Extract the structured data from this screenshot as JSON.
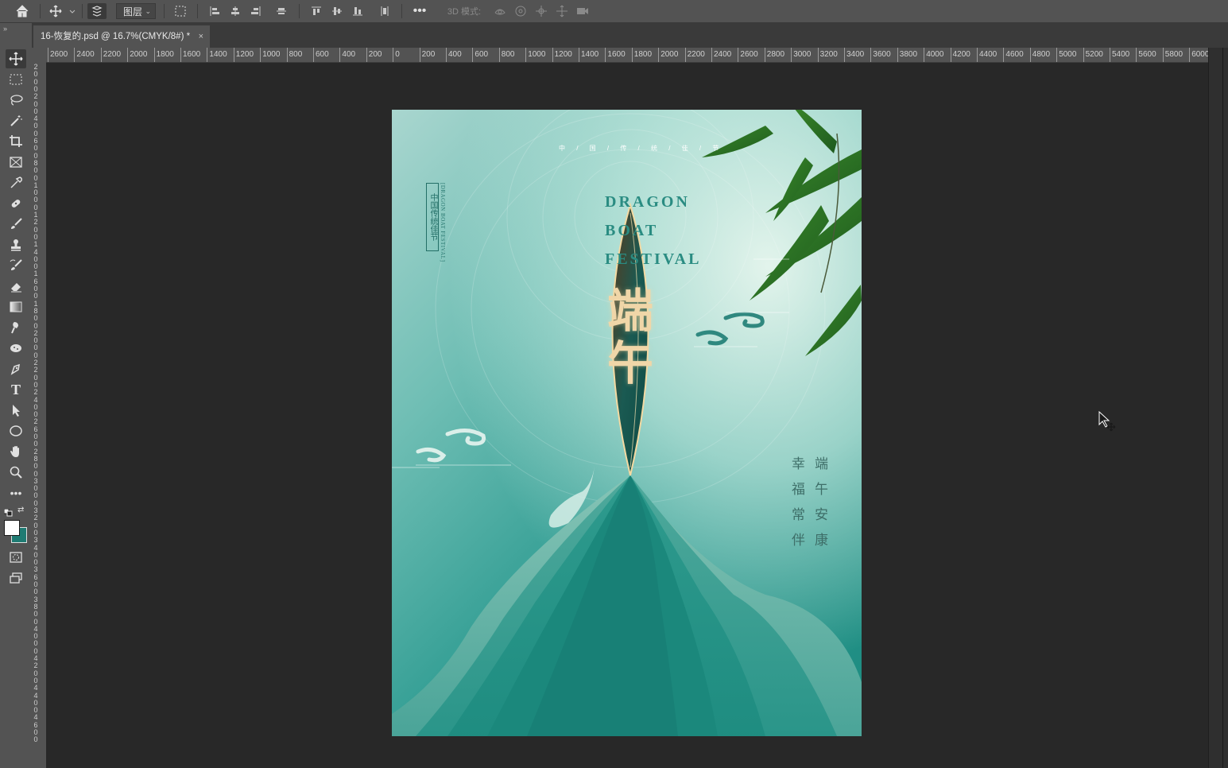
{
  "options_bar": {
    "layer_select_value": "图层",
    "three_d_mode_label": "3D 模式:"
  },
  "document_tab": {
    "title": "16-恢复的.psd @ 16.7%(CMYK/8#) *",
    "close_label": "×"
  },
  "ruler_top_labels": [
    "2600",
    "2400",
    "2200",
    "2000",
    "1800",
    "1600",
    "1400",
    "1200",
    "1000",
    "800",
    "600",
    "400",
    "200",
    "0",
    "200",
    "400",
    "600",
    "800",
    "1000",
    "1200",
    "1400",
    "1600",
    "1800",
    "2000",
    "2200",
    "2400",
    "2600",
    "2800",
    "3000",
    "3200",
    "3400",
    "3600",
    "3800",
    "4000",
    "4200",
    "4400",
    "4600",
    "4800",
    "5000",
    "5200",
    "5400",
    "5600",
    "5800",
    "6000"
  ],
  "ruler_left_labels": [
    "2",
    "0",
    "0",
    "0",
    "2",
    "0",
    "0",
    "4",
    "0",
    "0",
    "6",
    "0",
    "0",
    "8",
    "0",
    "0",
    "1",
    "0",
    "0",
    "0",
    "1",
    "2",
    "0",
    "0",
    "1",
    "4",
    "0",
    "0",
    "1",
    "6",
    "0",
    "0",
    "1",
    "8",
    "0",
    "0",
    "2",
    "0",
    "0",
    "0",
    "2",
    "2",
    "0",
    "0",
    "2",
    "4",
    "0",
    "0",
    "2",
    "6",
    "0",
    "0",
    "2",
    "8",
    "0",
    "0",
    "3",
    "0",
    "0",
    "0",
    "3",
    "2",
    "0",
    "0",
    "3",
    "4",
    "0",
    "0",
    "3",
    "6",
    "0",
    "0",
    "3",
    "8",
    "0",
    "0",
    "4",
    "0",
    "0",
    "0",
    "4",
    "2",
    "0",
    "0",
    "4",
    "4",
    "0",
    "0",
    "4",
    "6",
    "0",
    "0"
  ],
  "poster": {
    "top_line": "中 / 国 / 传 / 统 / 佳 / 节",
    "seal_text": "中国传统佳节",
    "seal_english": "[DRAGON BOAT FESTIVAL]",
    "english_title": [
      "DRAGON",
      "BOAT",
      "FESTIVAL"
    ],
    "chinese_title": [
      "端",
      "午"
    ],
    "blessing_right": "端午安康",
    "blessing_left": "幸福常伴"
  },
  "colors": {
    "ui_panel": "#535353",
    "ui_dark": "#282828",
    "teal_dark": "#1c8b80",
    "teal_light": "#a9d6cf",
    "gold": "#f0d6a8"
  }
}
